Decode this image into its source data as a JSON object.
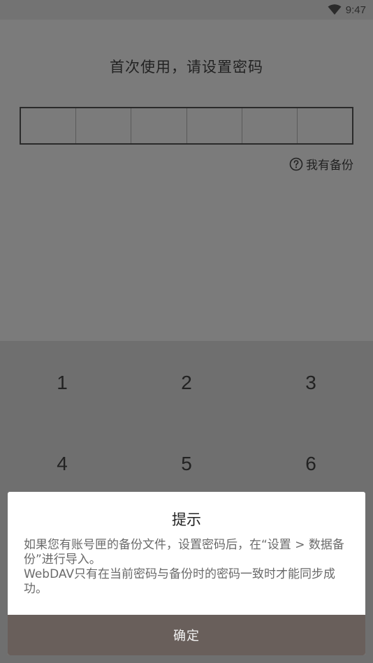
{
  "status_bar": {
    "time": "9:47",
    "wifi_icon": "wifi-icon"
  },
  "setup": {
    "title": "首次使用，请设置密码",
    "pin_length": 6,
    "backup_link_label": "我有备份",
    "backup_icon": "help-circle-icon"
  },
  "keypad": {
    "keys": [
      "1",
      "2",
      "3",
      "4",
      "5",
      "6"
    ]
  },
  "dialog": {
    "title": "提示",
    "message_lines": [
      "如果您有账号匣的备份文件，设置密码后，在“设置 > 数据备份”进行导入。",
      "WebDAV只有在当前密码与备份时的密码一致时才能同步成功。"
    ],
    "confirm_label": "确定"
  },
  "colors": {
    "overlay_background": "#7b7b7b",
    "keypad_background": "#6f6f6f",
    "confirm_button": "#695f5b",
    "dialog_background": "#ffffff"
  }
}
